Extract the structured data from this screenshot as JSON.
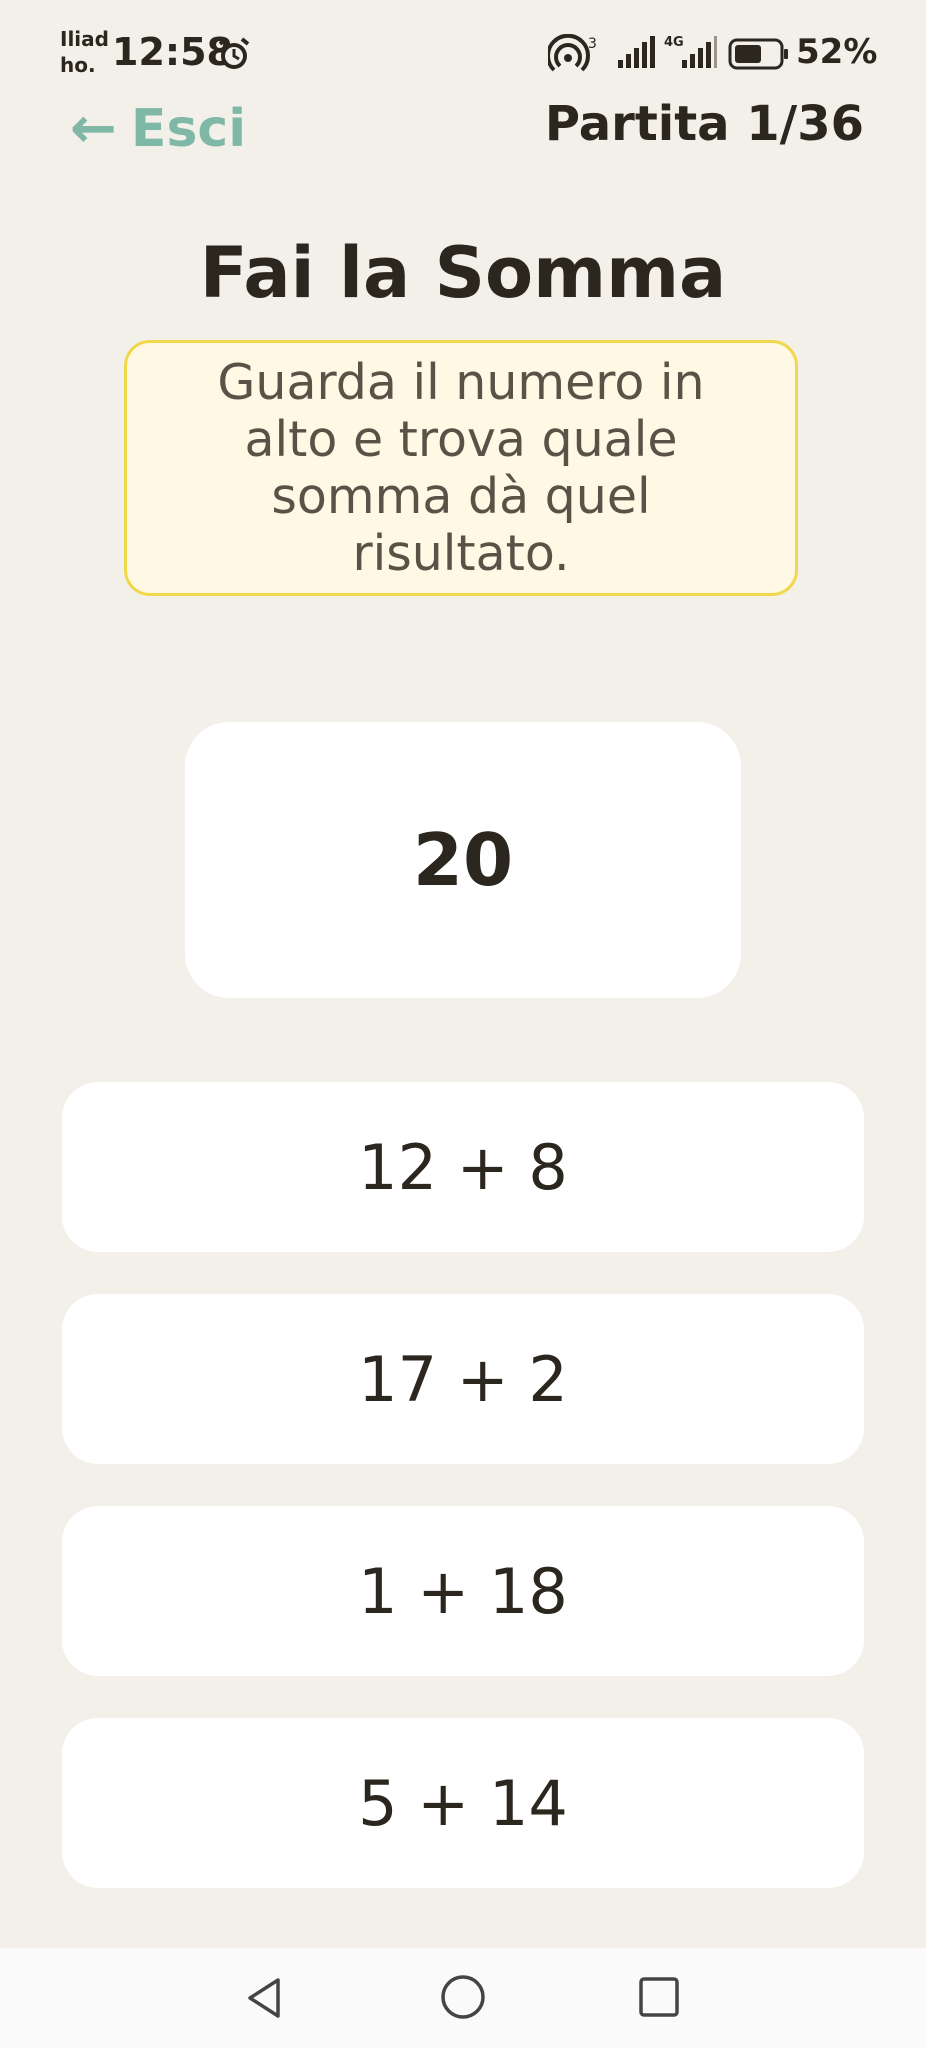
{
  "status_bar": {
    "carrier_line1": "Iliad",
    "carrier_line2": "ho.",
    "time": "12:58",
    "battery": "52%",
    "icons": [
      "alarm-icon",
      "hotspot-icon",
      "signal-icon",
      "4g-signal-icon",
      "battery-icon"
    ]
  },
  "header": {
    "back_arrow": "←",
    "back_label": "Esci",
    "progress": "Partita 1/36"
  },
  "game": {
    "title": "Fai la Somma",
    "instruction": "Guarda il numero in alto e trova quale somma dà quel risultato.",
    "target": "20",
    "options": [
      {
        "label": "12 + 8"
      },
      {
        "label": "17 + 2"
      },
      {
        "label": "1 + 18"
      },
      {
        "label": "5 + 14"
      }
    ]
  },
  "colors": {
    "background": "#f3f0e9",
    "accent": "#7fb8a6",
    "instruction_bg": "#fff8e5",
    "instruction_border": "#f0d84a",
    "card": "#ffffff",
    "text": "#2b261e"
  },
  "navigation": {
    "icons": [
      "back-triangle-icon",
      "home-circle-icon",
      "recents-square-icon"
    ]
  }
}
